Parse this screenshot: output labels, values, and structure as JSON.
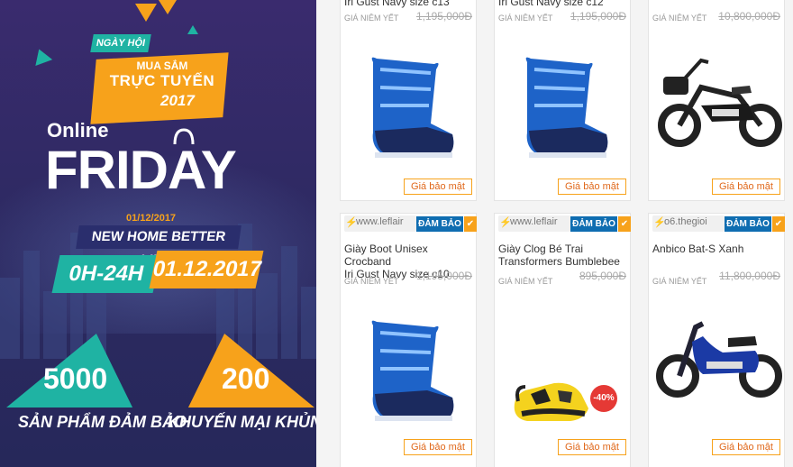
{
  "banner": {
    "event_ngay_hoi": "NGÀY HỘI",
    "event_line1": "MUA SẮM",
    "event_line2": "TRỰC TUYẾN",
    "event_year": "2017",
    "online": "Online",
    "friday": "FRIDAY",
    "date_small": "01/12/2017",
    "tagline": "NEW HOME BETTER LIFE",
    "time": "0H-24H",
    "date_big": "01.12.2017",
    "stat1_num": "5000",
    "stat1_label": "SẢN PHẨM ĐẢM BẢO",
    "stat2_num": "200",
    "stat2_label": "KHUYẾN MẠI KHỦNG",
    "colors": {
      "teal": "#1fb3a3",
      "orange": "#f7a21b",
      "navy": "#2e2a63"
    }
  },
  "products": {
    "row1": [
      {
        "name_tail": "Iri Gust Navy size c13",
        "price_label": "GIÁ NIÊM YẾT",
        "price": "1,195,000Đ",
        "button": "Giá bảo mật",
        "image": "blue-boot"
      },
      {
        "name_tail": "Iri Gust Navy size c12",
        "price_label": "GIÁ NIÊM YẾT",
        "price": "1,195,000Đ",
        "button": "Giá bảo mật",
        "image": "blue-boot"
      },
      {
        "price_label": "GIÁ NIÊM YẾT",
        "price": "10,800,000Đ",
        "button": "Giá bảo mật",
        "image": "black-scooter"
      }
    ],
    "row2": [
      {
        "store": "www.leflair",
        "badge": "ĐẢM BẢO",
        "name_line1": "Giày Boot Unisex Crocband",
        "name_line2": "Iri Gust Navy size c10",
        "price_label": "GIÁ NIÊM YẾT",
        "price": "1,195,000Đ",
        "button": "Giá bảo mật",
        "image": "blue-boot"
      },
      {
        "store": "www.leflair",
        "badge": "ĐẢM BẢO",
        "name_line1": "Giày Clog Bé Trai",
        "name_line2": "Transformers Bumblebee",
        "price_label": "GIÁ NIÊM YẾT",
        "price": "895,000Đ",
        "button": "Giá bảo mật",
        "image": "yellow-clog",
        "discount": "-40%"
      },
      {
        "store": "o6.thegioi",
        "badge": "ĐẢM BẢO",
        "name_line1": "Anbico Bat-S Xanh",
        "name_line2": "",
        "price_label": "GIÁ NIÊM YẾT",
        "price": "11,800,000Đ",
        "button": "Giá bảo mật",
        "image": "blue-scooter"
      }
    ]
  }
}
